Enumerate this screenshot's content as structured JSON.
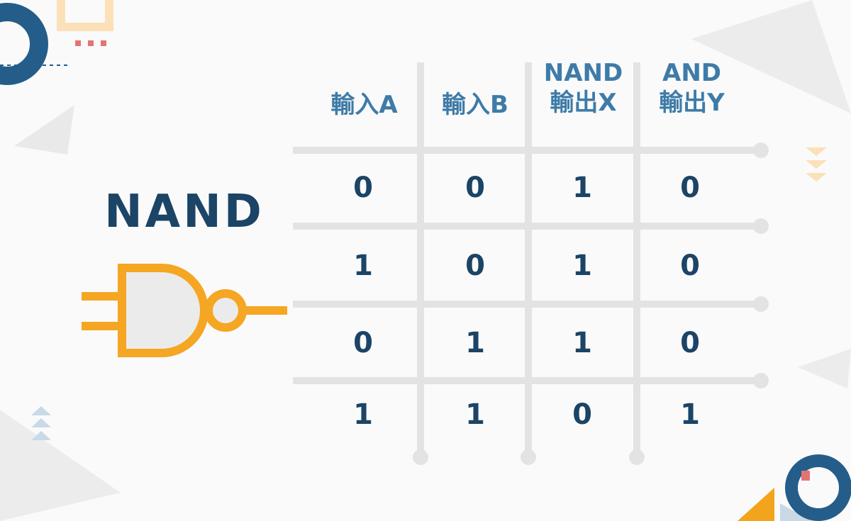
{
  "gate_name": "NAND",
  "table": {
    "headers": [
      {
        "line1": "輸入A",
        "line2": ""
      },
      {
        "line1": "輸入B",
        "line2": ""
      },
      {
        "line1": "NAND",
        "line2": "輸出X"
      },
      {
        "line1": "AND",
        "line2": "輸出Y"
      }
    ],
    "rows": [
      [
        "0",
        "0",
        "1",
        "0"
      ],
      [
        "1",
        "0",
        "1",
        "0"
      ],
      [
        "0",
        "1",
        "1",
        "0"
      ],
      [
        "1",
        "1",
        "0",
        "1"
      ]
    ]
  },
  "colors": {
    "gate_stroke": "#f5a623",
    "gate_fill": "#ebebeb",
    "grid": "#e3e3e3",
    "header_text": "#3e7ba8",
    "cell_text": "#1b4466"
  }
}
